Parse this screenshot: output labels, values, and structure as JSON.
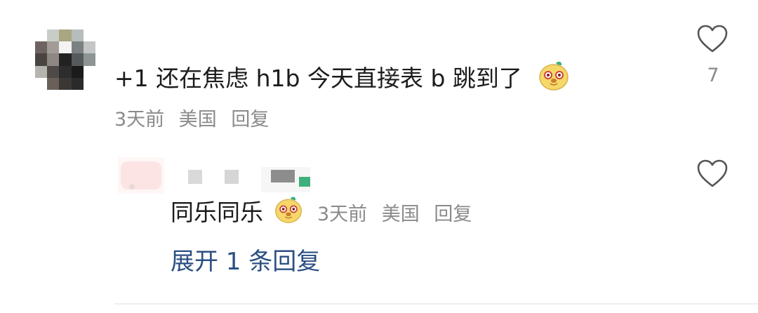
{
  "comment": {
    "text": "+1 还在焦虑 h1b 今天直接表 b 跳到了",
    "time": "3天前",
    "location": "美国",
    "reply_label": "回复",
    "like_count": "7",
    "emoji_name": "dog-emoji"
  },
  "reply": {
    "text": "同乐同乐",
    "time": "3天前",
    "location": "美国",
    "reply_label": "回复",
    "emoji_name": "dog-emoji"
  },
  "expand_label": "展开 1 条回复",
  "colors": {
    "text": "#1c1c1c",
    "meta": "#8a8a8a",
    "link": "#2b4f82",
    "emoji_fill": "#f6d76a",
    "divider": "#eeeeee"
  }
}
